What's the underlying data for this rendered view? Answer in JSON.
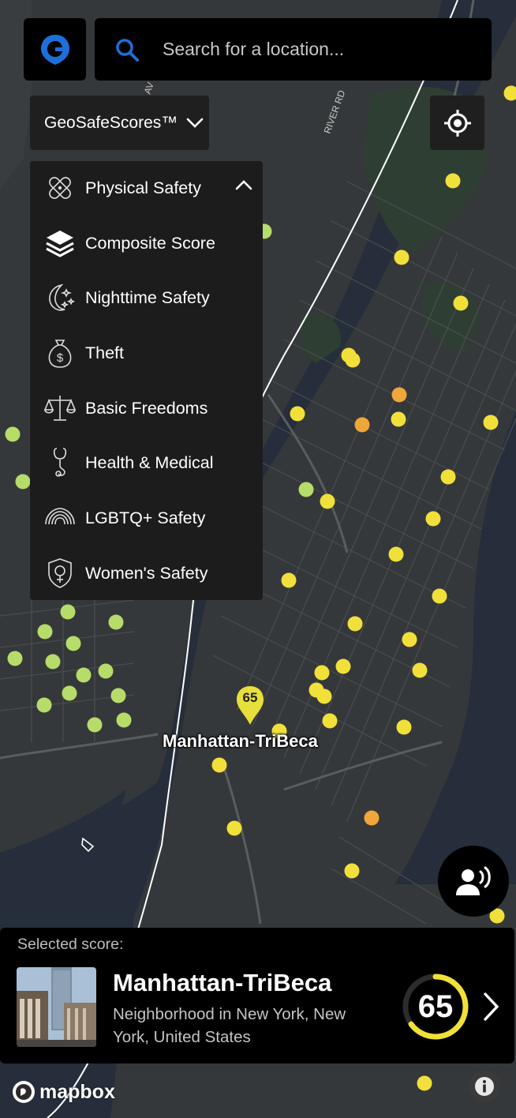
{
  "search": {
    "placeholder": "Search for a location..."
  },
  "scores_menu": {
    "label": "GeoSafeScores™",
    "items": [
      {
        "label": "Physical Safety",
        "icon": "bandage-icon"
      },
      {
        "label": "Composite Score",
        "icon": "layers-icon"
      },
      {
        "label": "Nighttime Safety",
        "icon": "moon-stars-icon"
      },
      {
        "label": "Theft",
        "icon": "money-bag-icon"
      },
      {
        "label": "Basic Freedoms",
        "icon": "scales-icon"
      },
      {
        "label": "Health & Medical",
        "icon": "stethoscope-icon"
      },
      {
        "label": "LGBTQ+ Safety",
        "icon": "rainbow-icon"
      },
      {
        "label": "Women's Safety",
        "icon": "female-shield-icon"
      }
    ]
  },
  "map": {
    "street_labels": [
      "RIVER RD",
      "AV"
    ],
    "selected_pin": {
      "label": "Manhattan-TriBeca",
      "value": "65"
    }
  },
  "panel": {
    "selected_label": "Selected score:",
    "name": "Manhattan-TriBeca",
    "description": "Neighborhood in New York, New York, United States",
    "score": "65",
    "score_fraction": 0.65
  },
  "attribution": {
    "text": "mapbox"
  },
  "colors": {
    "accent_blue": "#1e6fd9",
    "score_yellow": "#f2e03a",
    "green": "#b6dc6a",
    "orange": "#f0a63a"
  }
}
